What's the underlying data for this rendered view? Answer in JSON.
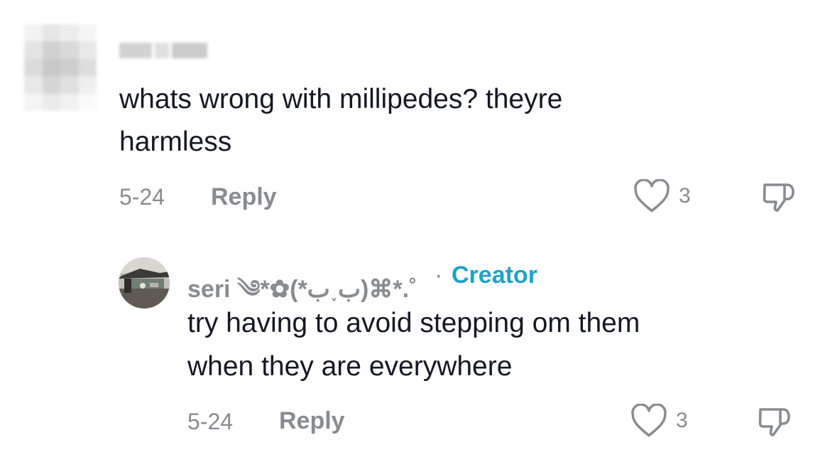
{
  "comment": {
    "text_line1": "whats wrong with millipedes? theyre",
    "text_line2": "harmless",
    "date": "5-24",
    "reply_label": "Reply",
    "likes": "3"
  },
  "reply": {
    "username": "seri ༄*✿(*ب˯ب)⌘*.˚",
    "separator": "·",
    "creator_badge": "Creator",
    "text_line1": "try having to avoid stepping om them",
    "text_line2": "when they are everywhere",
    "date": "5-24",
    "reply_label": "Reply",
    "likes": "3"
  },
  "colors": {
    "text": "#161823",
    "secondary": "#8a8b91",
    "creator": "#20a3c4"
  },
  "icons": {
    "like": "heart-outline-icon",
    "dislike": "thumbs-down-outline-icon"
  }
}
